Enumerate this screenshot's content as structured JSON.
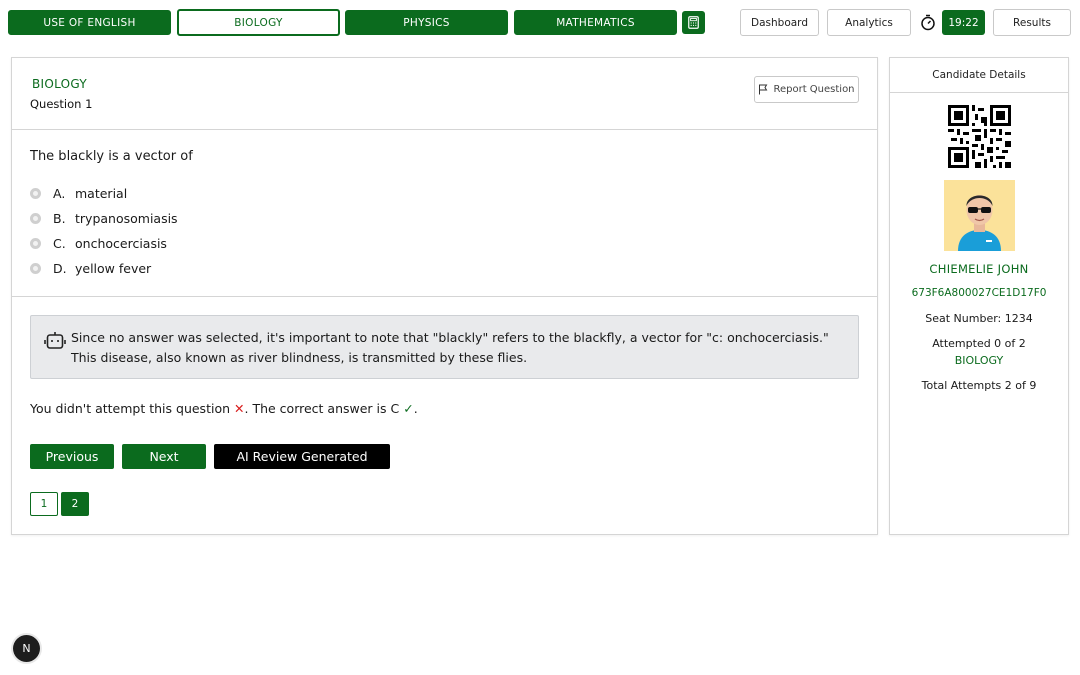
{
  "topbar": {
    "subjects": [
      "USE OF ENGLISH",
      "BIOLOGY",
      "PHYSICS",
      "MATHEMATICS"
    ],
    "active_subject": "BIOLOGY",
    "dashboard_label": "Dashboard",
    "analytics_label": "Analytics",
    "timer": "19:22",
    "results_label": "Results",
    "calculator_icon": "calculator-icon",
    "timer_icon": "stopwatch-icon"
  },
  "question": {
    "subject": "BIOLOGY",
    "number_label": "Question 1",
    "report_label": "Report Question",
    "text": "The blackly is a vector of",
    "options": [
      {
        "letter": "A.",
        "text": "material"
      },
      {
        "letter": "B.",
        "text": "trypanosomiasis"
      },
      {
        "letter": "C.",
        "text": "onchocerciasis"
      },
      {
        "letter": "D.",
        "text": "yellow fever"
      }
    ]
  },
  "review": {
    "text": "Since no answer was selected, it's important to note that \"blackly\" refers to the blackfly, a vector for \"c: onchocerciasis.\" This disease, also known as river blindness, is transmitted by these flies.",
    "result_part1": "You didn't attempt this question",
    "result_x": "✕",
    "result_part2": ". The correct answer is C",
    "result_check": "✓",
    "result_end": "."
  },
  "actions": {
    "previous": "Previous",
    "next": "Next",
    "ai_review": "AI Review Generated"
  },
  "pagination": [
    "1",
    "2"
  ],
  "candidate": {
    "header": "Candidate Details",
    "name": "CHIEMELIE JOHN",
    "id": "673F6A800027CE1D17F0",
    "seat": "Seat Number: 1234",
    "attempted": "Attempted 0 of 2",
    "attempted_subject": "BIOLOGY",
    "total_attempts": "Total Attempts 2 of 9"
  },
  "footer_badge": "N",
  "colors": {
    "primary_green": "#0b6b1e",
    "error_red": "#d81b1b",
    "review_bg": "#e9eaec"
  }
}
